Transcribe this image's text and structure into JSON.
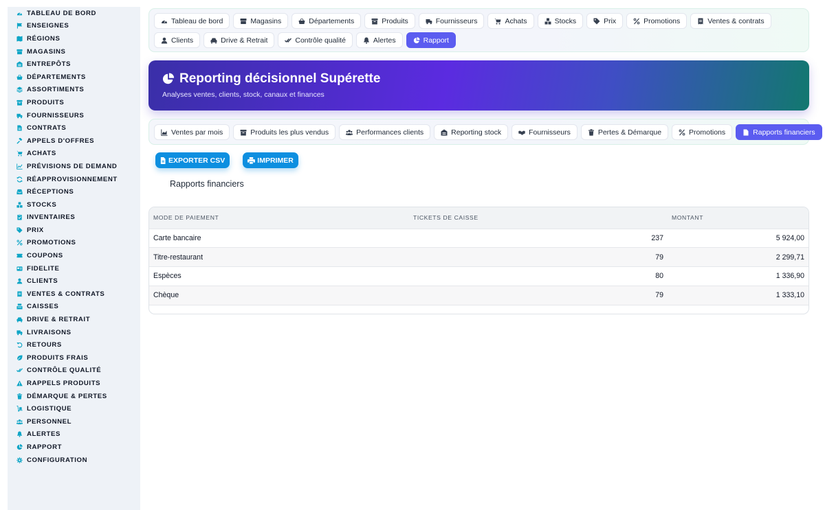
{
  "sidebar": {
    "items": [
      {
        "label": "TABLEAU DE BORD",
        "icon": "gauge-icon"
      },
      {
        "label": "ENSEIGNES",
        "icon": "flag-icon"
      },
      {
        "label": "RÉGIONS",
        "icon": "map-icon"
      },
      {
        "label": "MAGASINS",
        "icon": "store-icon"
      },
      {
        "label": "ENTREPÔTS",
        "icon": "warehouse-icon"
      },
      {
        "label": "DÉPARTEMENTS",
        "icon": "basket-icon"
      },
      {
        "label": "ASSORTIMENTS",
        "icon": "layers-icon"
      },
      {
        "label": "PRODUITS",
        "icon": "box-icon"
      },
      {
        "label": "FOURNISSEURS",
        "icon": "truck-icon"
      },
      {
        "label": "CONTRATS",
        "icon": "document-icon"
      },
      {
        "label": "APPELS D'OFFRES",
        "icon": "gavel-icon"
      },
      {
        "label": "ACHATS",
        "icon": "cart-icon"
      },
      {
        "label": "PRÉVISIONS DE DEMAND",
        "icon": "chart-line-icon"
      },
      {
        "label": "RÉAPPROVISIONNEMENT",
        "icon": "refresh-icon"
      },
      {
        "label": "RÉCEPTIONS",
        "icon": "inbox-icon"
      },
      {
        "label": "STOCKS",
        "icon": "boxes-icon"
      },
      {
        "label": "INVENTAIRES",
        "icon": "clipboard-icon"
      },
      {
        "label": "PRIX",
        "icon": "tag-icon"
      },
      {
        "label": "PROMOTIONS",
        "icon": "percent-icon"
      },
      {
        "label": "COUPONS",
        "icon": "ticket-icon"
      },
      {
        "label": "FIDELITE",
        "icon": "card-icon"
      },
      {
        "label": "CLIENTS",
        "icon": "user-icon"
      },
      {
        "label": "VENTES & CONTRATS",
        "icon": "receipt-icon"
      },
      {
        "label": "CAISSES",
        "icon": "cash-register-icon"
      },
      {
        "label": "DRIVE & RETRAIT",
        "icon": "car-icon"
      },
      {
        "label": "LIVRAISONS",
        "icon": "delivery-truck-icon"
      },
      {
        "label": "RETOURS",
        "icon": "undo-icon"
      },
      {
        "label": "PRODUITS FRAIS",
        "icon": "leaf-icon"
      },
      {
        "label": "CONTRÔLE QUALITÉ",
        "icon": "check-double-icon"
      },
      {
        "label": "RAPPELS PRODUITS",
        "icon": "warning-icon"
      },
      {
        "label": "DÉMARQUE & PERTES",
        "icon": "trash-icon"
      },
      {
        "label": "LOGISTIQUE",
        "icon": "dolly-icon"
      },
      {
        "label": "PERSONNEL",
        "icon": "users-icon"
      },
      {
        "label": "ALERTES",
        "icon": "bell-icon"
      },
      {
        "label": "RAPPORT",
        "icon": "pie-chart-icon"
      },
      {
        "label": "CONFIGURATION",
        "icon": "gear-icon"
      }
    ]
  },
  "topnav": {
    "items": [
      {
        "label": "Tableau de bord",
        "icon": "gauge-icon"
      },
      {
        "label": "Magasins",
        "icon": "store-icon"
      },
      {
        "label": "Départements",
        "icon": "basket-icon"
      },
      {
        "label": "Produits",
        "icon": "box-icon"
      },
      {
        "label": "Fournisseurs",
        "icon": "truck-icon"
      },
      {
        "label": "Achats",
        "icon": "cart-icon"
      },
      {
        "label": "Stocks",
        "icon": "boxes-icon"
      },
      {
        "label": "Prix",
        "icon": "tag-icon"
      },
      {
        "label": "Promotions",
        "icon": "percent-icon"
      },
      {
        "label": "Ventes & contrats",
        "icon": "receipt-icon"
      },
      {
        "label": "Clients",
        "icon": "user-icon"
      },
      {
        "label": "Drive & Retrait",
        "icon": "car-icon"
      },
      {
        "label": "Contrôle qualité",
        "icon": "check-double-icon"
      },
      {
        "label": "Alertes",
        "icon": "bell-icon"
      },
      {
        "label": "Rapport",
        "icon": "pie-chart-icon",
        "active": true
      }
    ]
  },
  "hero": {
    "title": "Reporting décisionnel Supérette",
    "subtitle": "Analyses ventes, clients, stock, canaux et finances",
    "icon": "pie-chart-icon"
  },
  "subnav": {
    "items": [
      {
        "label": "Ventes par mois",
        "icon": "chart-area-icon"
      },
      {
        "label": "Produits les plus vendus",
        "icon": "box-icon"
      },
      {
        "label": "Performances clients",
        "icon": "users-icon"
      },
      {
        "label": "Reporting stock",
        "icon": "warehouse-icon"
      },
      {
        "label": "Fournisseurs",
        "icon": "handshake-icon"
      },
      {
        "label": "Pertes & Démarque",
        "icon": "trash-icon"
      },
      {
        "label": "Promotions",
        "icon": "percent-icon"
      },
      {
        "label": "Rapports financiers",
        "icon": "document-icon",
        "active": true
      }
    ]
  },
  "actions": {
    "export_label": "EXPORTER CSV",
    "print_label": "IMPRIMER"
  },
  "section": {
    "title": "Rapports financiers"
  },
  "table": {
    "headers": [
      "MODE DE PAIEMENT",
      "TICKETS DE CAISSE",
      "MONTANT"
    ],
    "rows": [
      [
        "Carte bancaire",
        "237",
        "5 924,00"
      ],
      [
        "Titre-restaurant",
        "79",
        "2 299,71"
      ],
      [
        "Espèces",
        "80",
        "1 336,90"
      ],
      [
        "Chèque",
        "79",
        "1 333,10"
      ]
    ]
  },
  "colors": {
    "accent": "#5b5cf0",
    "button": "#0d8fe0",
    "sidebar_icon": "#0ea5c6",
    "sidebar_bg": "#eef2f7"
  }
}
